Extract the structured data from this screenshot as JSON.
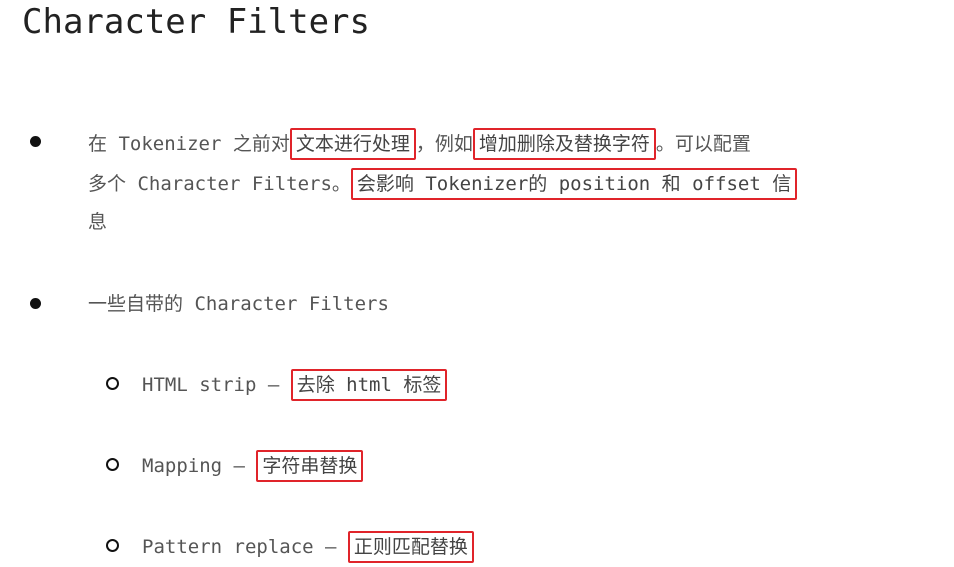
{
  "title": "Character Filters",
  "bullet1": {
    "line1_pre": "在 Tokenizer 之前对",
    "line1_hl1": "文本进行处理",
    "line1_mid": "，例如",
    "line1_hl2": "增加删除及替换字符",
    "line1_post": "。可以配置",
    "line2_pre": "多个 Character Filters。",
    "line2_hl": "会影响 Tokenizer的 position 和 offset 信",
    "line3": "息"
  },
  "bullet2": {
    "text": "一些自带的 Character Filters",
    "subitems": [
      {
        "label": "HTML strip  – ",
        "highlight": "去除 html 标签"
      },
      {
        "label": "Mapping  – ",
        "highlight": "字符串替换"
      },
      {
        "label": "Pattern replace  – ",
        "highlight": "正则匹配替换"
      }
    ]
  }
}
